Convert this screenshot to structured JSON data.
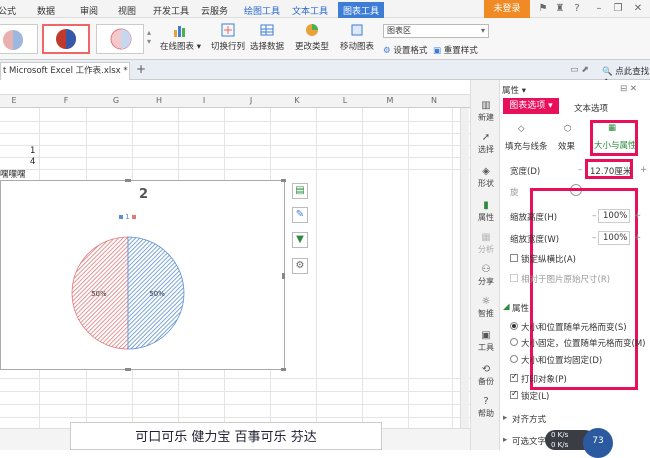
{
  "menubar": {
    "items": [
      "公式",
      "数据",
      "审阅",
      "视图",
      "开发工具",
      "云服务",
      "绘图工具",
      "文本工具",
      "图表工具"
    ],
    "login": "未登录"
  },
  "ribbon": {
    "online_chart": "在线图表",
    "switch_row_col": "切换行列",
    "select_data": "选择数据",
    "change_type": "更改类型",
    "move_chart": "移动图表",
    "chart_area": "图表区",
    "set_format": "设置格式",
    "reset_style": "重置样式"
  },
  "tabs": {
    "doc": "t Microsoft Excel 工作表.xlsx *",
    "new": "+",
    "locate_placeholder": "点此查找命"
  },
  "sheet": {
    "columns": [
      "E",
      "F",
      "G",
      "H",
      "I",
      "J",
      "K",
      "L",
      "M",
      "N"
    ],
    "cells": [
      "1",
      "4",
      "嘿嘿嘿"
    ]
  },
  "chart": {
    "title": "2",
    "legend": [
      "1"
    ],
    "slices": [
      {
        "label": "50%",
        "value": 50,
        "color": "#e07a7a"
      },
      {
        "label": "50%",
        "value": 50,
        "color": "#5b8fd0"
      }
    ]
  },
  "textbox": {
    "text": "可口可乐 健力宝 百事可乐 芬达"
  },
  "sidebar": {
    "items": [
      "新建",
      "选择",
      "形状",
      "属性",
      "分析",
      "分享",
      "智推",
      "工具",
      "备份",
      "帮助"
    ]
  },
  "panel": {
    "header": "属性 ▾",
    "tab_chart_options": "图表选项 ▾",
    "tab_text_options": "文本选项",
    "sub_fill_line": "填充与线条",
    "sub_effect": "效果",
    "sub_size_attr": "大小与属性",
    "width_label": "宽度(D)",
    "width_value": "12.70厘米",
    "rotate_label": "旋",
    "scale_height_label": "缩放高度(H)",
    "scale_height_value": "100%",
    "scale_width_label": "缩放宽度(W)",
    "scale_width_value": "100%",
    "lock_ratio": "锁定纵横比(A)",
    "relative_original": "相对于图片原始尺寸(R)",
    "attributes": "属性",
    "radio_move_size": "大小和位置随单元格而变(S)",
    "radio_fixed_size": "大小固定，位置随单元格而变(M)",
    "radio_fixed_both": "大小和位置均固定(D)",
    "print_object": "打印对象(P)",
    "locked": "锁定(L)",
    "align": "对齐方式",
    "optional_text": "可选文字"
  },
  "speed": {
    "up": "0 K/s",
    "down": "0 K/s",
    "gauge": "73"
  }
}
